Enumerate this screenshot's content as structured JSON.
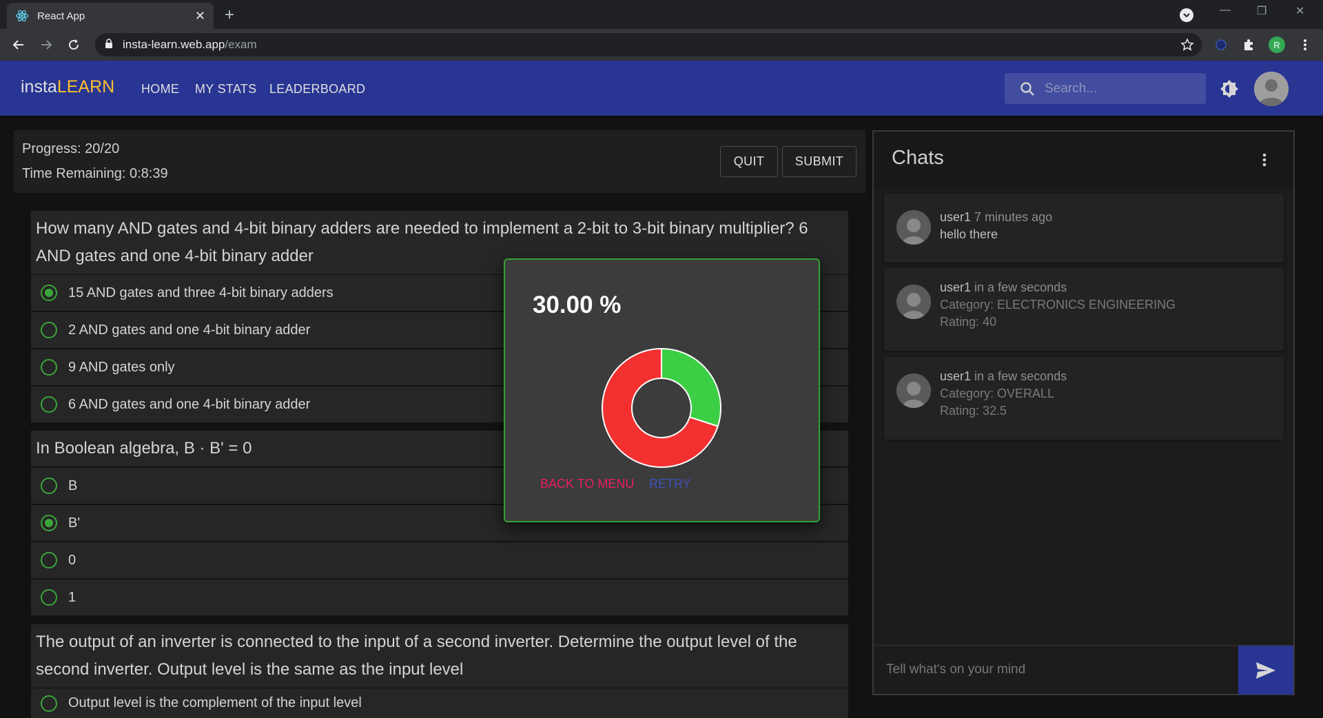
{
  "browser": {
    "tab_title": "React App",
    "url_host": "insta-learn.web.app",
    "url_path": "/exam",
    "profile_initial": "R"
  },
  "appbar": {
    "brand_part1": "insta",
    "brand_part2": "LEARN",
    "nav": [
      "HOME",
      "MY STATS",
      "LEADERBOARD"
    ],
    "search_placeholder": "Search..."
  },
  "exam": {
    "progress": "Progress: 20/20",
    "time": "Time Remaining: 0:8:39",
    "quit_label": "QUIT",
    "submit_label": "SUBMIT",
    "questions": [
      {
        "text": "How many AND gates and 4-bit binary adders are needed to implement a 2-bit to 3-bit binary multiplier? 6 AND gates and one 4-bit binary adder",
        "options": [
          "15 AND gates and three 4-bit binary adders",
          "2 AND gates and one 4-bit binary adder",
          "9 AND gates only",
          "6 AND gates and one 4-bit binary adder"
        ],
        "selected": 0
      },
      {
        "text": "In Boolean algebra, B · B' = 0",
        "options": [
          "B",
          "B'",
          "0",
          "1"
        ],
        "selected": 1
      },
      {
        "text": "The output of an inverter is connected to the input of a second inverter. Determine the output level of the second inverter. Output level is the same as the input level",
        "options": [
          "Output level is the complement of the input level"
        ],
        "selected": -1
      }
    ]
  },
  "result": {
    "score": "30.00 %",
    "score_value": 30,
    "colors": {
      "correct": "#3cce44",
      "wrong": "#f33030"
    },
    "back_label": "BACK TO MENU",
    "retry_label": "RETRY"
  },
  "chats": {
    "title": "Chats",
    "messages": [
      {
        "user": "user1",
        "time": "7 minutes ago",
        "lines": [
          "hello there"
        ]
      },
      {
        "user": "user1",
        "time": "in a few seconds",
        "lines": [
          "Category: ELECTRONICS ENGINEERING",
          "Rating: 40"
        ]
      },
      {
        "user": "user1",
        "time": "in a few seconds",
        "lines": [
          "Category: OVERALL",
          "Rating: 32.5"
        ]
      }
    ],
    "input_placeholder": "Tell what's on your mind"
  }
}
